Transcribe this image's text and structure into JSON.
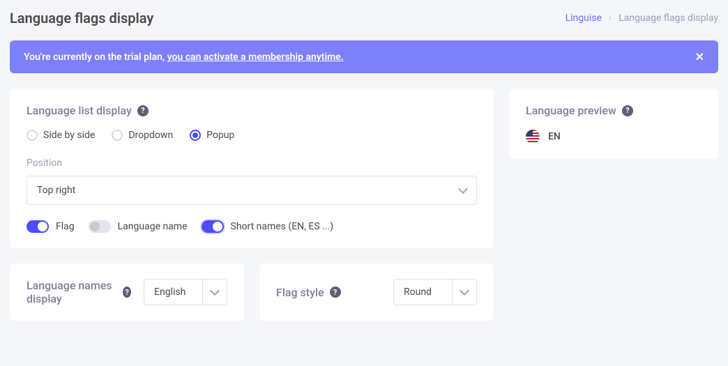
{
  "header": {
    "title": "Language flags display"
  },
  "breadcrumb": {
    "root": "Linguise",
    "current": "Language flags display"
  },
  "banner": {
    "prefix": "You're currently on the trial plan, ",
    "link": "you can activate a membership anytime.",
    "close": "✕"
  },
  "listDisplay": {
    "heading": "Language list display",
    "options": {
      "side": "Side by side",
      "dropdown": "Dropdown",
      "popup": "Popup"
    },
    "positionLabel": "Position",
    "positionValue": "Top right",
    "toggles": {
      "flag": "Flag",
      "langName": "Language name",
      "shortNames": "Short names (EN, ES ...)"
    }
  },
  "langNames": {
    "heading": "Language names display",
    "value": "English"
  },
  "flagStyle": {
    "heading": "Flag style",
    "value": "Round"
  },
  "preview": {
    "heading": "Language preview",
    "code": "EN"
  }
}
